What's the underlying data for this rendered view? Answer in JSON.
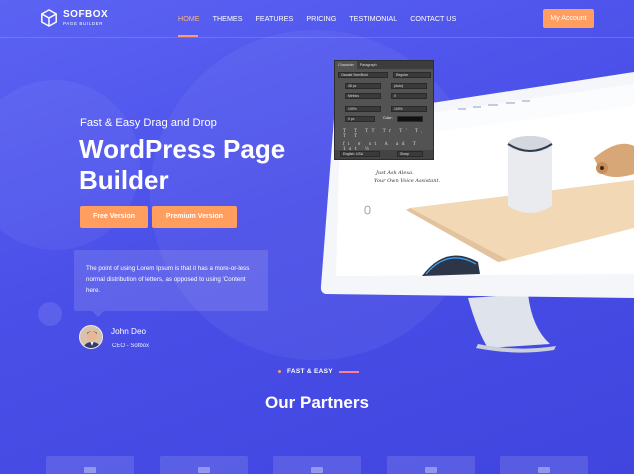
{
  "brand": {
    "name": "SOFBOX",
    "sub": "PAGE BUILDER"
  },
  "nav": {
    "items": [
      "HOME",
      "THEMES",
      "FEATURES",
      "PRICING",
      "TESTIMONIAL",
      "CONTACT US"
    ]
  },
  "header": {
    "account_label": "My Account"
  },
  "hero": {
    "tagline": "Fast & Easy Drag and Drop",
    "title": "WordPress Page Builder",
    "free_label": "Free Version",
    "premium_label": "Premium Version",
    "quote": "The point of using Lorem Ipsum is that it has a more-or-less normal distribution of letters, as opposed to using 'Content here.",
    "author_name": "John Deo",
    "author_role": "CEO - Sofbox"
  },
  "screen": {
    "caption_1": "Just Ask Alexa.",
    "caption_2": "Your Own Voice Assistant."
  },
  "ps_panel": {
    "tab_character": "Character",
    "tab_paragraph": "Paragraph",
    "font": "Oswald SemiBold",
    "style": "Regular",
    "size": "48 px",
    "leading": "(Auto)",
    "kerning": "Metrics",
    "tracking": "0",
    "vscale": "100%",
    "hscale": "100%",
    "baseline": "0 px",
    "color_label": "Color:",
    "language": "English: USA",
    "aa": "Sharp"
  },
  "section": {
    "kicker": "FAST & EASY",
    "title": "Our Partners"
  },
  "colors": {
    "accent": "#ff9e5e",
    "bg": "#4a4fe8"
  }
}
